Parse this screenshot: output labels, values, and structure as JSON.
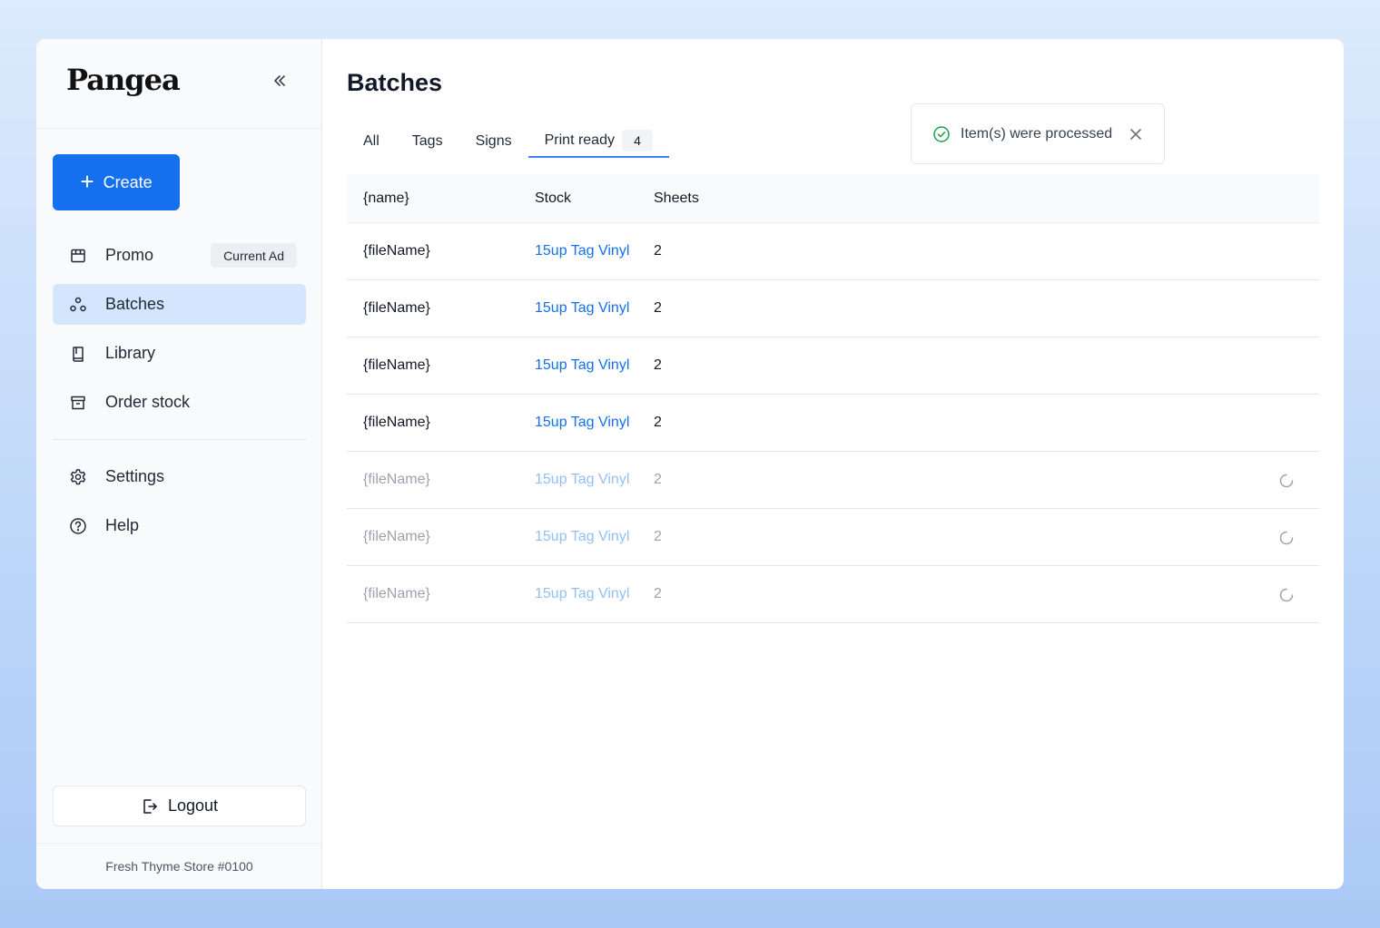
{
  "brand": {
    "logo_text": "Pangea"
  },
  "sidebar": {
    "create_label": "Create",
    "items": [
      {
        "label": "Promo",
        "icon": "storefront-icon",
        "badge": "Current Ad"
      },
      {
        "label": "Batches",
        "icon": "batches-icon",
        "active": true
      },
      {
        "label": "Library",
        "icon": "book-icon"
      },
      {
        "label": "Order stock",
        "icon": "archive-icon"
      },
      {
        "label": "Settings",
        "icon": "gear-icon"
      },
      {
        "label": "Help",
        "icon": "help-icon"
      }
    ],
    "logout_label": "Logout",
    "store_name": "Fresh Thyme Store #0100"
  },
  "main": {
    "title": "Batches",
    "tabs": [
      {
        "label": "All"
      },
      {
        "label": "Tags"
      },
      {
        "label": "Signs"
      },
      {
        "label": "Print ready",
        "count": "4",
        "active": true
      }
    ],
    "table": {
      "headers": [
        "{name}",
        "Stock",
        "Sheets"
      ],
      "rows": [
        {
          "name": "{fileName}",
          "stock": "15up Tag Vinyl",
          "sheets": "2",
          "pending": false
        },
        {
          "name": "{fileName}",
          "stock": "15up Tag Vinyl",
          "sheets": "2",
          "pending": false
        },
        {
          "name": "{fileName}",
          "stock": "15up Tag Vinyl",
          "sheets": "2",
          "pending": false
        },
        {
          "name": "{fileName}",
          "stock": "15up Tag Vinyl",
          "sheets": "2",
          "pending": false
        },
        {
          "name": "{fileName}",
          "stock": "15up Tag Vinyl",
          "sheets": "2",
          "pending": true
        },
        {
          "name": "{fileName}",
          "stock": "15up Tag Vinyl",
          "sheets": "2",
          "pending": true
        },
        {
          "name": "{fileName}",
          "stock": "15up Tag Vinyl",
          "sheets": "2",
          "pending": true
        }
      ]
    }
  },
  "toast": {
    "message": "Item(s) were processed",
    "status": "success"
  },
  "colors": {
    "accent": "#1570ef",
    "active_nav": "#d4e6fd",
    "success": "#16a34a"
  }
}
